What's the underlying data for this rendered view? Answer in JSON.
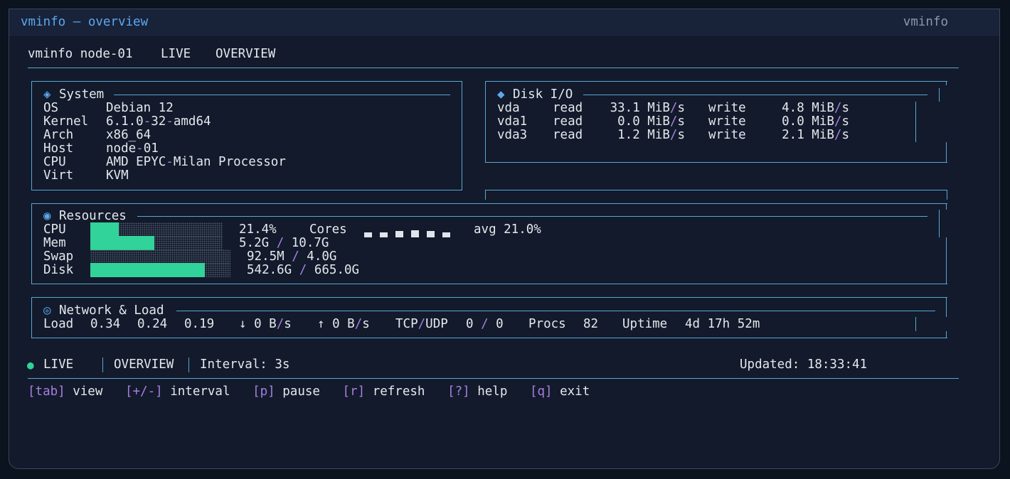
{
  "window": {
    "title": "vminfo — overview",
    "app_name": "vminfo"
  },
  "header": {
    "host": "vminfo node-01",
    "mode": "LIVE",
    "view": "OVERVIEW"
  },
  "system": {
    "title": "System",
    "rows": [
      {
        "key": "OS",
        "value": "Debian 12"
      },
      {
        "key": "Kernel",
        "value": "6.1.0-32-amd64"
      },
      {
        "key": "Arch",
        "value": "x86_64"
      },
      {
        "key": "Host",
        "value": "node-01"
      },
      {
        "key": "CPU",
        "value": "AMD EPYC-Milan Processor"
      },
      {
        "key": "Virt",
        "value": "KVM"
      }
    ]
  },
  "disk_io": {
    "title": "Disk I/O",
    "read_label": "read",
    "write_label": "write",
    "devices": [
      {
        "name": "vda",
        "read": "33.1 MiB/s",
        "write": "4.8 MiB/s"
      },
      {
        "name": "vda1",
        "read": "0.0 MiB/s",
        "write": "0.0 MiB/s"
      },
      {
        "name": "vda3",
        "read": "1.2 MiB/s",
        "write": "2.1 MiB/s"
      }
    ]
  },
  "resources": {
    "title": "Resources",
    "cpu": {
      "label": "CPU",
      "percent": 21.4,
      "text": "21.4%"
    },
    "mem": {
      "label": "Mem",
      "fraction": 0.486,
      "text": "5.2G / 10.7G"
    },
    "swap": {
      "label": "Swap",
      "fraction": 0.0,
      "text": "92.5M / 4.0G"
    },
    "disk": {
      "label": "Disk",
      "fraction": 0.815,
      "text": "542.6G / 665.0G"
    },
    "cores_label": "Cores",
    "core_levels": [
      0.5,
      0.5,
      0.75,
      1.0,
      0.75,
      0.5
    ],
    "avg_text": "avg 21.0%"
  },
  "network": {
    "title": "Network & Load",
    "load_label": "Load",
    "load": [
      "0.34",
      "0.24",
      "0.19"
    ],
    "down": "↓ 0 B/s",
    "up": "↑ 0 B/s",
    "tcpudp_label": "TCP/UDP",
    "tcpudp_value": "0 / 0",
    "procs_label": "Procs",
    "procs_value": "82",
    "uptime_label": "Uptime",
    "uptime_value": "4d 17h 52m"
  },
  "status": {
    "live": "LIVE",
    "view": "OVERVIEW",
    "interval": "Interval: 3s",
    "updated": "Updated: 18:33:41"
  },
  "keys": [
    {
      "key": "[tab]",
      "label": "view"
    },
    {
      "key": "[+/-]",
      "label": "interval"
    },
    {
      "key": "[p]",
      "label": "pause"
    },
    {
      "key": "[r]",
      "label": "refresh"
    },
    {
      "key": "[?]",
      "label": "help"
    },
    {
      "key": "[q]",
      "label": "exit"
    }
  ],
  "colors": {
    "accent": "#5ca8ee",
    "border": "#5aa7d3",
    "bar_fill": "#31d39b",
    "key_hint": "#a97ee0"
  },
  "icons": {
    "system": "diamond-outline-icon",
    "disk_io": "diamond-icon",
    "resources": "circle-dot-icon",
    "network": "bullseye-icon",
    "live": "green-dot-icon"
  }
}
